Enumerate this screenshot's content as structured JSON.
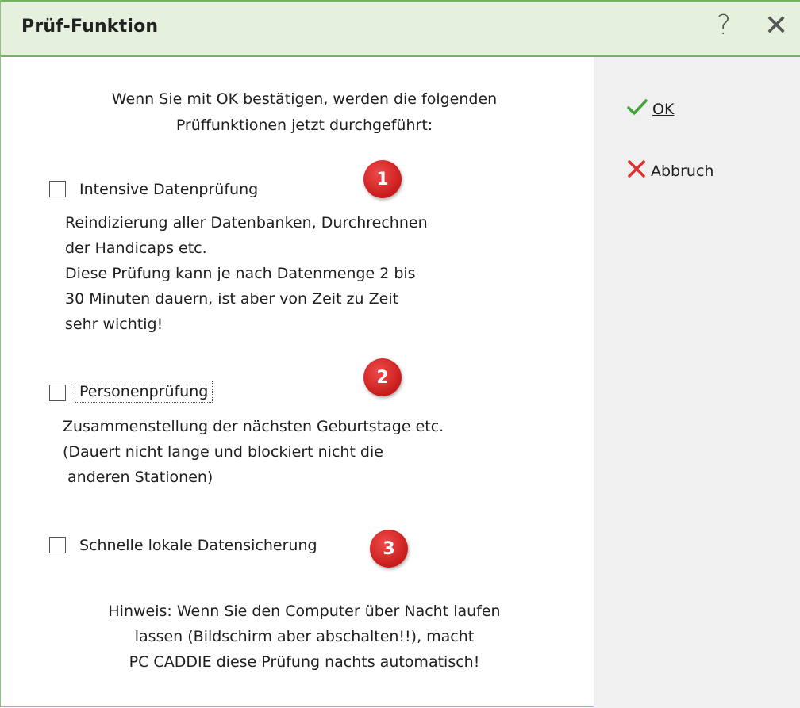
{
  "window": {
    "title": "Prüf-Funktion",
    "help_glyph": "?",
    "close_glyph": "✕"
  },
  "intro": {
    "line1": "Wenn Sie mit OK bestätigen, werden die folgenden",
    "line2": "Prüffunktionen jetzt durchgeführt:"
  },
  "options": [
    {
      "label": "Intensive Datenprüfung",
      "checked": false,
      "badge": "1",
      "description": [
        "Reindizierung aller Datenbanken, Durchrechnen",
        "der Handicaps etc.",
        "Diese Prüfung kann je nach Datenmenge 2 bis",
        "30 Minuten dauern, ist aber von Zeit zu Zeit",
        "sehr wichtig!"
      ]
    },
    {
      "label": "Personenprüfung",
      "checked": false,
      "badge": "2",
      "description": [
        "Zusammenstellung der nächsten Geburtstage etc.",
        "(Dauert nicht lange und blockiert nicht die",
        " anderen Stationen)"
      ]
    },
    {
      "label": "Schnelle lokale Datensicherung",
      "checked": false,
      "badge": "3",
      "description": []
    }
  ],
  "hint": {
    "line1": "Hinweis: Wenn Sie den Computer über Nacht laufen",
    "line2": "lassen (Bildschirm aber abschalten!!), macht",
    "line3": "PC CADDIE diese Prüfung nachts automatisch!"
  },
  "buttons": {
    "ok_label": "OK",
    "ok_icon": "check-icon",
    "cancel_label": "Abbruch",
    "cancel_icon": "x-icon"
  },
  "colors": {
    "titlebar_bg": "#e6f1dd",
    "titlebar_border": "#6fb35a",
    "badge": "#d42525",
    "ok_icon": "#3fa535",
    "cancel_icon": "#e03030",
    "side_panel": "#f0f0f0"
  }
}
